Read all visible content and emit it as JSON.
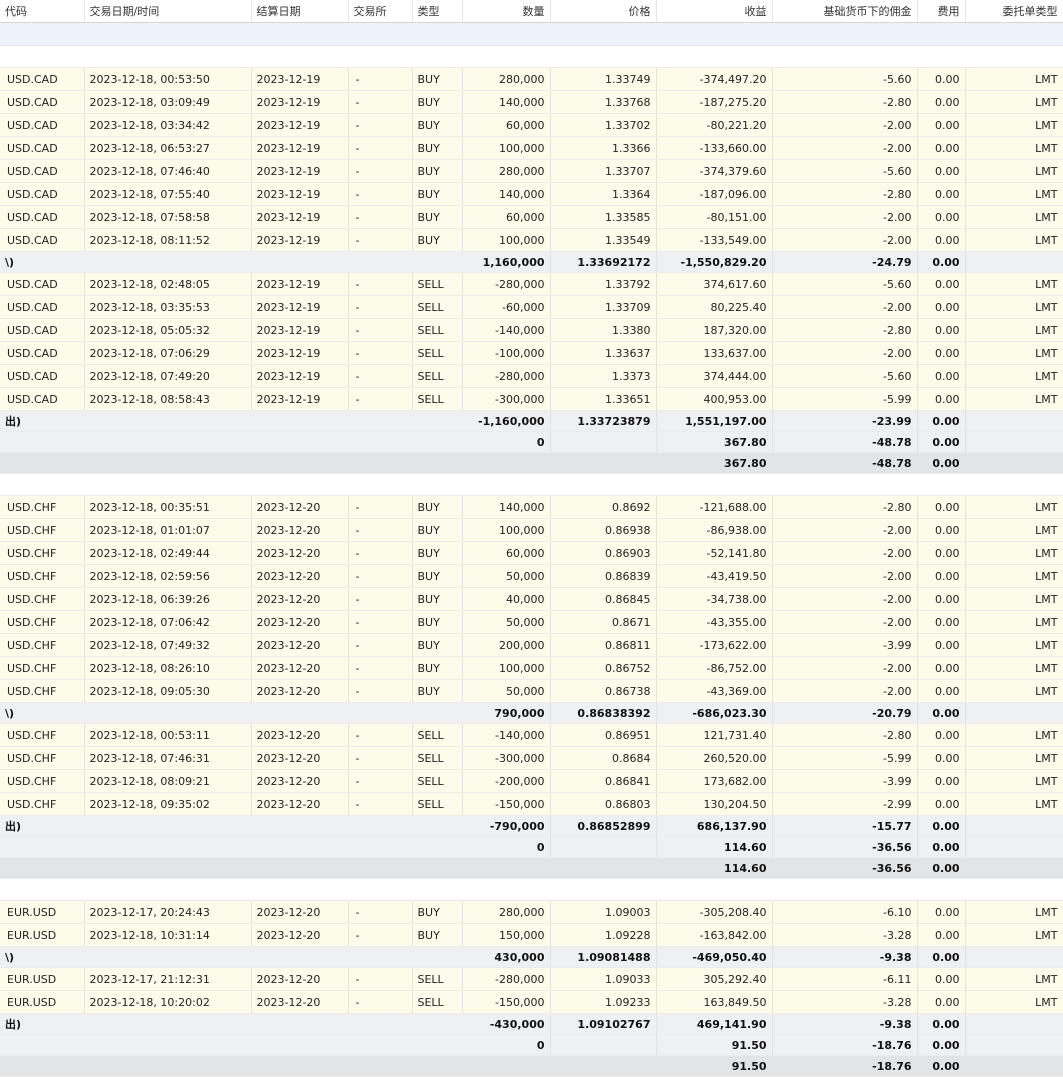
{
  "header": {
    "columns": [
      "代码",
      "交易日期/时间",
      "结算日期",
      "交易所",
      "类型",
      "数量",
      "价格",
      "收益",
      "基础货币下的佣金",
      "费用",
      "委托单类型"
    ]
  },
  "groups": [
    {
      "buys": [
        [
          "USD.CAD",
          "2023-12-18, 00:53:50",
          "2023-12-19",
          "-",
          "BUY",
          "280,000",
          "1.33749",
          "-374,497.20",
          "-5.60",
          "0.00",
          "LMT"
        ],
        [
          "USD.CAD",
          "2023-12-18, 03:09:49",
          "2023-12-19",
          "-",
          "BUY",
          "140,000",
          "1.33768",
          "-187,275.20",
          "-2.80",
          "0.00",
          "LMT"
        ],
        [
          "USD.CAD",
          "2023-12-18, 03:34:42",
          "2023-12-19",
          "-",
          "BUY",
          "60,000",
          "1.33702",
          "-80,221.20",
          "-2.00",
          "0.00",
          "LMT"
        ],
        [
          "USD.CAD",
          "2023-12-18, 06:53:27",
          "2023-12-19",
          "-",
          "BUY",
          "100,000",
          "1.3366",
          "-133,660.00",
          "-2.00",
          "0.00",
          "LMT"
        ],
        [
          "USD.CAD",
          "2023-12-18, 07:46:40",
          "2023-12-19",
          "-",
          "BUY",
          "280,000",
          "1.33707",
          "-374,379.60",
          "-5.60",
          "0.00",
          "LMT"
        ],
        [
          "USD.CAD",
          "2023-12-18, 07:55:40",
          "2023-12-19",
          "-",
          "BUY",
          "140,000",
          "1.3364",
          "-187,096.00",
          "-2.80",
          "0.00",
          "LMT"
        ],
        [
          "USD.CAD",
          "2023-12-18, 07:58:58",
          "2023-12-19",
          "-",
          "BUY",
          "60,000",
          "1.33585",
          "-80,151.00",
          "-2.00",
          "0.00",
          "LMT"
        ],
        [
          "USD.CAD",
          "2023-12-18, 08:11:52",
          "2023-12-19",
          "-",
          "BUY",
          "100,000",
          "1.33549",
          "-133,549.00",
          "-2.00",
          "0.00",
          "LMT"
        ]
      ],
      "buy_total": {
        "label": "\\)",
        "qty": "1,160,000",
        "price": "1.33692172",
        "proceeds": "-1,550,829.20",
        "comm": "-24.79",
        "fee": "0.00"
      },
      "sells": [
        [
          "USD.CAD",
          "2023-12-18, 02:48:05",
          "2023-12-19",
          "-",
          "SELL",
          "-280,000",
          "1.33792",
          "374,617.60",
          "-5.60",
          "0.00",
          "LMT"
        ],
        [
          "USD.CAD",
          "2023-12-18, 03:35:53",
          "2023-12-19",
          "-",
          "SELL",
          "-60,000",
          "1.33709",
          "80,225.40",
          "-2.00",
          "0.00",
          "LMT"
        ],
        [
          "USD.CAD",
          "2023-12-18, 05:05:32",
          "2023-12-19",
          "-",
          "SELL",
          "-140,000",
          "1.3380",
          "187,320.00",
          "-2.80",
          "0.00",
          "LMT"
        ],
        [
          "USD.CAD",
          "2023-12-18, 07:06:29",
          "2023-12-19",
          "-",
          "SELL",
          "-100,000",
          "1.33637",
          "133,637.00",
          "-2.00",
          "0.00",
          "LMT"
        ],
        [
          "USD.CAD",
          "2023-12-18, 07:49:20",
          "2023-12-19",
          "-",
          "SELL",
          "-280,000",
          "1.3373",
          "374,444.00",
          "-5.60",
          "0.00",
          "LMT"
        ],
        [
          "USD.CAD",
          "2023-12-18, 08:58:43",
          "2023-12-19",
          "-",
          "SELL",
          "-300,000",
          "1.33651",
          "400,953.00",
          "-5.99",
          "0.00",
          "LMT"
        ]
      ],
      "sell_total": {
        "label": "出)",
        "qty": "-1,160,000",
        "price": "1.33723879",
        "proceeds": "1,551,197.00",
        "comm": "-23.99",
        "fee": "0.00"
      },
      "net": {
        "qty": "0",
        "proceeds": "367.80",
        "comm": "-48.78",
        "fee": "0.00"
      },
      "grand": {
        "proceeds": "367.80",
        "comm": "-48.78",
        "fee": "0.00"
      }
    },
    {
      "buys": [
        [
          "USD.CHF",
          "2023-12-18, 00:35:51",
          "2023-12-20",
          "-",
          "BUY",
          "140,000",
          "0.8692",
          "-121,688.00",
          "-2.80",
          "0.00",
          "LMT"
        ],
        [
          "USD.CHF",
          "2023-12-18, 01:01:07",
          "2023-12-20",
          "-",
          "BUY",
          "100,000",
          "0.86938",
          "-86,938.00",
          "-2.00",
          "0.00",
          "LMT"
        ],
        [
          "USD.CHF",
          "2023-12-18, 02:49:44",
          "2023-12-20",
          "-",
          "BUY",
          "60,000",
          "0.86903",
          "-52,141.80",
          "-2.00",
          "0.00",
          "LMT"
        ],
        [
          "USD.CHF",
          "2023-12-18, 02:59:56",
          "2023-12-20",
          "-",
          "BUY",
          "50,000",
          "0.86839",
          "-43,419.50",
          "-2.00",
          "0.00",
          "LMT"
        ],
        [
          "USD.CHF",
          "2023-12-18, 06:39:26",
          "2023-12-20",
          "-",
          "BUY",
          "40,000",
          "0.86845",
          "-34,738.00",
          "-2.00",
          "0.00",
          "LMT"
        ],
        [
          "USD.CHF",
          "2023-12-18, 07:06:42",
          "2023-12-20",
          "-",
          "BUY",
          "50,000",
          "0.8671",
          "-43,355.00",
          "-2.00",
          "0.00",
          "LMT"
        ],
        [
          "USD.CHF",
          "2023-12-18, 07:49:32",
          "2023-12-20",
          "-",
          "BUY",
          "200,000",
          "0.86811",
          "-173,622.00",
          "-3.99",
          "0.00",
          "LMT"
        ],
        [
          "USD.CHF",
          "2023-12-18, 08:26:10",
          "2023-12-20",
          "-",
          "BUY",
          "100,000",
          "0.86752",
          "-86,752.00",
          "-2.00",
          "0.00",
          "LMT"
        ],
        [
          "USD.CHF",
          "2023-12-18, 09:05:30",
          "2023-12-20",
          "-",
          "BUY",
          "50,000",
          "0.86738",
          "-43,369.00",
          "-2.00",
          "0.00",
          "LMT"
        ]
      ],
      "buy_total": {
        "label": "\\)",
        "qty": "790,000",
        "price": "0.86838392",
        "proceeds": "-686,023.30",
        "comm": "-20.79",
        "fee": "0.00"
      },
      "sells": [
        [
          "USD.CHF",
          "2023-12-18, 00:53:11",
          "2023-12-20",
          "-",
          "SELL",
          "-140,000",
          "0.86951",
          "121,731.40",
          "-2.80",
          "0.00",
          "LMT"
        ],
        [
          "USD.CHF",
          "2023-12-18, 07:46:31",
          "2023-12-20",
          "-",
          "SELL",
          "-300,000",
          "0.8684",
          "260,520.00",
          "-5.99",
          "0.00",
          "LMT"
        ],
        [
          "USD.CHF",
          "2023-12-18, 08:09:21",
          "2023-12-20",
          "-",
          "SELL",
          "-200,000",
          "0.86841",
          "173,682.00",
          "-3.99",
          "0.00",
          "LMT"
        ],
        [
          "USD.CHF",
          "2023-12-18, 09:35:02",
          "2023-12-20",
          "-",
          "SELL",
          "-150,000",
          "0.86803",
          "130,204.50",
          "-2.99",
          "0.00",
          "LMT"
        ]
      ],
      "sell_total": {
        "label": "出)",
        "qty": "-790,000",
        "price": "0.86852899",
        "proceeds": "686,137.90",
        "comm": "-15.77",
        "fee": "0.00"
      },
      "net": {
        "qty": "0",
        "proceeds": "114.60",
        "comm": "-36.56",
        "fee": "0.00"
      },
      "grand": {
        "proceeds": "114.60",
        "comm": "-36.56",
        "fee": "0.00"
      }
    },
    {
      "buys": [
        [
          "EUR.USD",
          "2023-12-17, 20:24:43",
          "2023-12-20",
          "-",
          "BUY",
          "280,000",
          "1.09003",
          "-305,208.40",
          "-6.10",
          "0.00",
          "LMT"
        ],
        [
          "EUR.USD",
          "2023-12-18, 10:31:14",
          "2023-12-20",
          "-",
          "BUY",
          "150,000",
          "1.09228",
          "-163,842.00",
          "-3.28",
          "0.00",
          "LMT"
        ]
      ],
      "buy_total": {
        "label": "\\)",
        "qty": "430,000",
        "price": "1.09081488",
        "proceeds": "-469,050.40",
        "comm": "-9.38",
        "fee": "0.00"
      },
      "sells": [
        [
          "EUR.USD",
          "2023-12-17, 21:12:31",
          "2023-12-20",
          "-",
          "SELL",
          "-280,000",
          "1.09033",
          "305,292.40",
          "-6.11",
          "0.00",
          "LMT"
        ],
        [
          "EUR.USD",
          "2023-12-18, 10:20:02",
          "2023-12-20",
          "-",
          "SELL",
          "-150,000",
          "1.09233",
          "163,849.50",
          "-3.28",
          "0.00",
          "LMT"
        ]
      ],
      "sell_total": {
        "label": "出)",
        "qty": "-430,000",
        "price": "1.09102767",
        "proceeds": "469,141.90",
        "comm": "-9.38",
        "fee": "0.00"
      },
      "net": {
        "qty": "0",
        "proceeds": "91.50",
        "comm": "-18.76",
        "fee": "0.00"
      },
      "grand": {
        "proceeds": "91.50",
        "comm": "-18.76",
        "fee": "0.00"
      }
    }
  ]
}
